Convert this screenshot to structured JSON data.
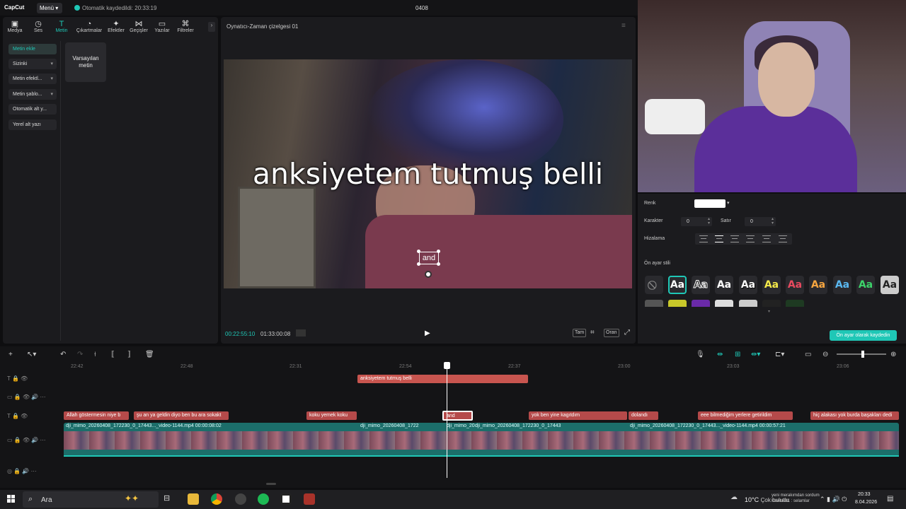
{
  "app": {
    "logo": "CapCut",
    "menu_label": "Menü",
    "autosave": "Otomatik kaydedildi: 20:33:19",
    "project_title": "0408"
  },
  "toolbar": {
    "items": [
      {
        "label": "Medya",
        "icon": "media-icon"
      },
      {
        "label": "Ses",
        "icon": "audio-icon"
      },
      {
        "label": "Metin",
        "icon": "text-icon"
      },
      {
        "label": "Çıkartmalar",
        "icon": "sticker-icon"
      },
      {
        "label": "Efektler",
        "icon": "effects-icon"
      },
      {
        "label": "Geçişler",
        "icon": "transitions-icon"
      },
      {
        "label": "Yazılar",
        "icon": "captions-icon"
      },
      {
        "label": "Filtreler",
        "icon": "filters-icon"
      }
    ],
    "active": "Metin"
  },
  "sidebar": {
    "items": [
      {
        "label": "Metin ekle"
      },
      {
        "label": "Sizinki"
      },
      {
        "label": "Metin efektl..."
      },
      {
        "label": "Metin şablo..."
      },
      {
        "label": "Otomatik alt y..."
      },
      {
        "label": "Yerel alt yazı"
      }
    ]
  },
  "text_panel": {
    "default_card": "Varsayılan metin"
  },
  "player": {
    "title": "Oynatıcı-Zaman çizelgesi 01",
    "caption": "anksiyetem tutmuş belli",
    "selected_text": "and",
    "current_time": "00:22:55:10",
    "total_time": "01:33:00:08",
    "btn_full": "Tam",
    "btn_ratio": "Oran"
  },
  "props": {
    "color_label": "Renk",
    "color_value": "#ffffff",
    "char_label": "Karakter",
    "char_value": "0",
    "line_label": "Satır",
    "line_value": "0",
    "align_label": "Hizalama",
    "preset_label": "Ön ayar stili",
    "preset_glyph": "Aa",
    "save_preset": "Ön ayar olarak kaydedin"
  },
  "timeline": {
    "ruler": [
      "22:42",
      "22:48",
      "22:31",
      "22:54",
      "22:37",
      "23:00",
      "23:03",
      "23:06"
    ],
    "upper_text_clip": "anksiyetem tutmuş belli",
    "text_clips": [
      "Allah göstermesin niye b",
      "şu an ya geldin diyo ben bu ara sokakt",
      "koku yemek koku",
      "and",
      "yok ben yine kagıtdım",
      "dolandı",
      "eee bilmediğim yerlere getirildim",
      "hiç alakası yok burda başakları dedi"
    ],
    "video_clips": [
      "dji_mimo_20260408_172230_0_17443..._video-1144.mp4  00:00:08:02",
      "dji_mimo_20260408_1722",
      "dji_mimo_20",
      "dji_mimo_20260408_172230_0_17443",
      "dji_mimo_20260408_172230_0_17443..._video-1144.mp4  00:00:57:21"
    ]
  },
  "taskbar": {
    "search_placeholder": "Ara",
    "temperature": "10°C",
    "weather": "Çok bulutlu",
    "notif_line1": "yeni merakımdan sordum",
    "notif_line2": "Kewmall1 : selamlar",
    "time": "20:33",
    "date": "8.04.2026"
  }
}
